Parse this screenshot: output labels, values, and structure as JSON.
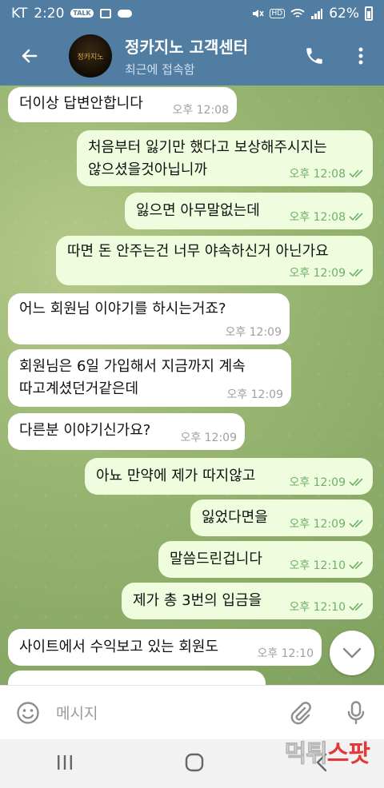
{
  "status": {
    "carrier": "KT",
    "time": "2:20",
    "talk_badge": "TALK",
    "battery": "62%"
  },
  "header": {
    "title": "정카지노 고객센터",
    "subtitle": "최근에 접속함",
    "avatar_text": "정카지노"
  },
  "messages": [
    {
      "text": "더이상 답변안합니다",
      "time": "오후 12:08"
    },
    {
      "text": "처음부터 잃기만 했다고 보상해주시지는\n않으셨을것아닙니까",
      "time": "오후 12:08"
    },
    {
      "text": "잃으면 아무말없는데",
      "time": "오후 12:08"
    },
    {
      "text": "따면 돈 안주는건 너무 야속하신거 아닌가요",
      "time": "오후 12:09"
    },
    {
      "text": "어느 회원님 이야기를 하시는거죠?",
      "time": "오후 12:09"
    },
    {
      "text": "회원님은 6일 가입해서 지금까지 계속\n따고계셨던거같은데",
      "time": "오후 12:09"
    },
    {
      "text": "다른분 이야기신가요?",
      "time": "오후 12:09"
    },
    {
      "text": "아뇨 만약에 제가 따지않고",
      "time": "오후 12:09"
    },
    {
      "text": "잃었다면을",
      "time": "오후 12:09"
    },
    {
      "text": "말씀드린겁니다",
      "time": "오후 12:10"
    },
    {
      "text": "제가 총 3번의 입금을",
      "time": "오후 12:10"
    },
    {
      "text": "사이트에서 수익보고 있는 회원도",
      "time": "오후 12:10"
    },
    {
      "text": ""
    }
  ],
  "input": {
    "placeholder": "메시지"
  },
  "watermark": {
    "part1": "먹튀",
    "part2": "스팟"
  },
  "colors": {
    "header": "#517da2",
    "bubble_in": "#ffffff",
    "bubble_out": "#effdde",
    "check": "#6fb06a"
  }
}
